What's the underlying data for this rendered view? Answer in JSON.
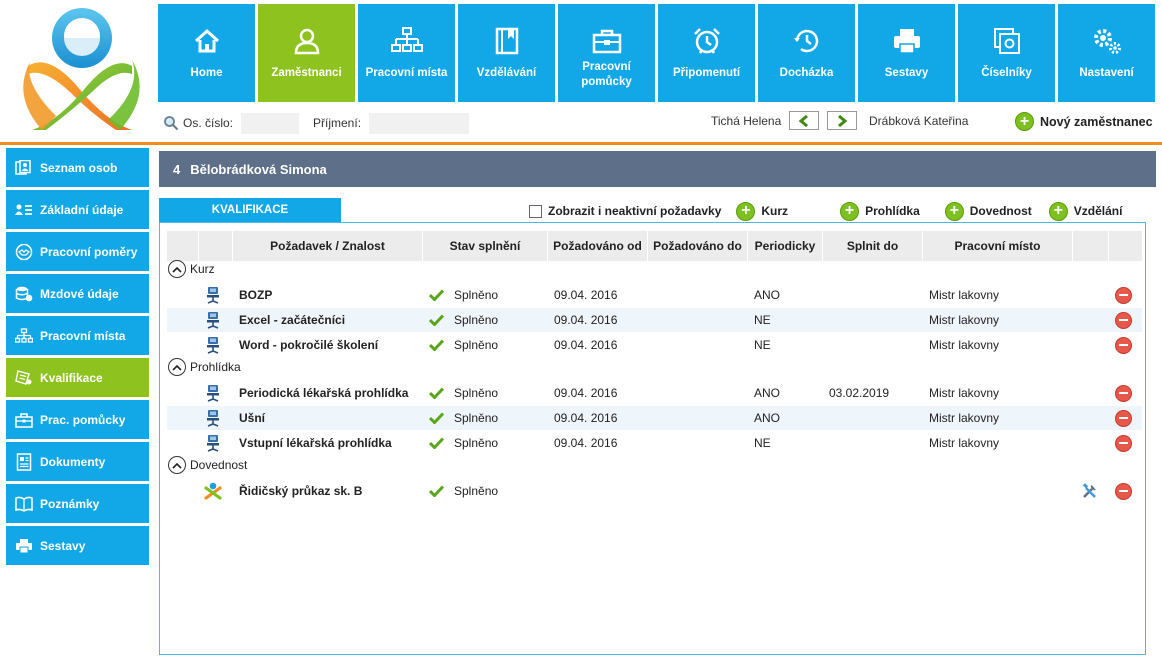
{
  "nav": [
    {
      "label": "Home",
      "icon": "home-icon",
      "active": false
    },
    {
      "label": "Zaměstnanci",
      "icon": "person-icon",
      "active": true
    },
    {
      "label": "Pracovní místa",
      "icon": "org-chart-icon",
      "active": false
    },
    {
      "label": "Vzdělávání",
      "icon": "book-icon",
      "active": false
    },
    {
      "label": "Pracovní pomůcky",
      "icon": "toolbox-icon",
      "active": false
    },
    {
      "label": "Připomenutí",
      "icon": "alarm-clock-icon",
      "active": false
    },
    {
      "label": "Docházka",
      "icon": "clock-history-icon",
      "active": false
    },
    {
      "label": "Sestavy",
      "icon": "printer-icon",
      "active": false
    },
    {
      "label": "Číselníky",
      "icon": "code-list-icon",
      "active": false
    },
    {
      "label": "Nastavení",
      "icon": "gears-icon",
      "active": false
    }
  ],
  "search": {
    "os_cislo_label": "Os. číslo:",
    "os_cislo_value": "",
    "prijmeni_label": "Příjmení:",
    "prijmeni_value": ""
  },
  "navigation": {
    "prev_name": "Tichá Helena",
    "next_name": "Drábková Kateřina",
    "new_employee": "Nový zaměstnanec"
  },
  "sidebar": [
    {
      "label": "Seznam osob",
      "icon": "people-list-icon",
      "active": false
    },
    {
      "label": "Základní údaje",
      "icon": "id-card-icon",
      "active": false
    },
    {
      "label": "Pracovní poměry",
      "icon": "handshake-icon",
      "active": false
    },
    {
      "label": "Mzdové údaje",
      "icon": "coins-icon",
      "active": false
    },
    {
      "label": "Pracovní místa",
      "icon": "org-chart-icon",
      "active": false
    },
    {
      "label": "Kvalifikace",
      "icon": "certificate-icon",
      "active": true
    },
    {
      "label": "Prac. pomůcky",
      "icon": "toolbox-icon",
      "active": false
    },
    {
      "label": "Dokumenty",
      "icon": "document-icon",
      "active": false
    },
    {
      "label": "Poznámky",
      "icon": "notes-icon",
      "active": false
    },
    {
      "label": "Sestavy",
      "icon": "printer-icon",
      "active": false
    }
  ],
  "employee": {
    "number": "4",
    "name": "Bělobrádková Simona"
  },
  "tab": {
    "label": "KVALIFIKACE"
  },
  "actions": {
    "show_inactive": "Zobrazit i neaktivní požadavky",
    "show_inactive_checked": false,
    "add_kurz": "Kurz",
    "add_prohlidka": "Prohlídka",
    "add_dovednost": "Dovednost",
    "add_vzdelani": "Vzdělání"
  },
  "table": {
    "columns": [
      "Požadavek / Znalost",
      "Stav splnění",
      "Požadováno od",
      "Požadováno do",
      "Periodicky",
      "Splnit do",
      "Pracovní místo"
    ],
    "groups": [
      {
        "name": "Kurz",
        "rows": [
          {
            "name": "BOZP",
            "stav": "Splněno",
            "od": "09.04. 2016",
            "do": "",
            "periodicky": "ANO",
            "splnit": "",
            "misto": "Mistr lakovny"
          },
          {
            "name": "Excel - začátečníci",
            "stav": "Splněno",
            "od": "09.04. 2016",
            "do": "",
            "periodicky": "NE",
            "splnit": "",
            "misto": "Mistr lakovny"
          },
          {
            "name": "Word - pokročilé školení",
            "stav": "Splněno",
            "od": "09.04. 2016",
            "do": "",
            "periodicky": "NE",
            "splnit": "",
            "misto": "Mistr lakovny"
          }
        ]
      },
      {
        "name": "Prohlídka",
        "rows": [
          {
            "name": "Periodická lékařská prohlídka",
            "stav": "Splněno",
            "od": "09.04. 2016",
            "do": "",
            "periodicky": "ANO",
            "splnit": "03.02.2019",
            "misto": "Mistr lakovny"
          },
          {
            "name": "Ušní",
            "stav": "Splněno",
            "od": "09.04. 2016",
            "do": "",
            "periodicky": "ANO",
            "splnit": "",
            "misto": "Mistr lakovny"
          },
          {
            "name": "Vstupní lékařská prohlídka",
            "stav": "Splněno",
            "od": "09.04. 2016",
            "do": "",
            "periodicky": "NE",
            "splnit": "",
            "misto": "Mistr lakovny"
          }
        ]
      },
      {
        "name": "Dovednost",
        "rows": [
          {
            "name": "Řidičský průkaz sk. B",
            "stav": "Splněno",
            "od": "",
            "do": "",
            "periodicky": "",
            "splnit": "",
            "misto": ""
          }
        ]
      }
    ]
  },
  "colors": {
    "blue": "#12a7e6",
    "green": "#8dc21f",
    "orange": "#ef8a1f",
    "header": "#5e6f8a",
    "delete": "#e8584a"
  }
}
